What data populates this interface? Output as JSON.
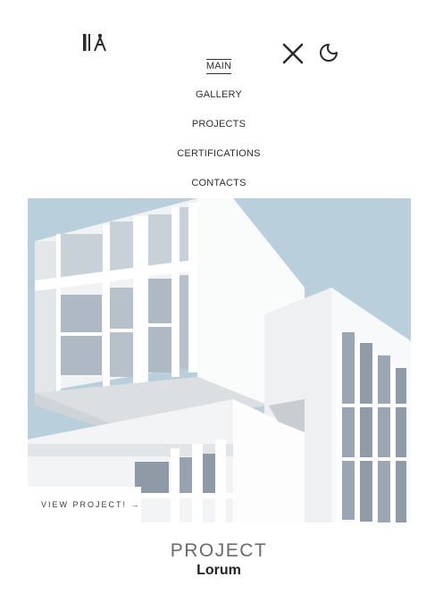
{
  "header": {
    "logo_icon": "architect-logo-icon",
    "close_icon": "close-icon",
    "theme_icon": "moon-icon"
  },
  "nav": {
    "items": [
      {
        "label": "MAIN",
        "active": true
      },
      {
        "label": "GALLERY",
        "active": false
      },
      {
        "label": "PROJECTS",
        "active": false
      },
      {
        "label": "CERTIFICATIONS",
        "active": false
      },
      {
        "label": "CONTACTS",
        "active": false
      }
    ]
  },
  "project": {
    "cta_label": "VIEW PROJECT! →",
    "label": "PROJECT",
    "name": "Lorum"
  },
  "colors": {
    "sky": "#b9cfdc",
    "text": "#2b2b2b"
  }
}
